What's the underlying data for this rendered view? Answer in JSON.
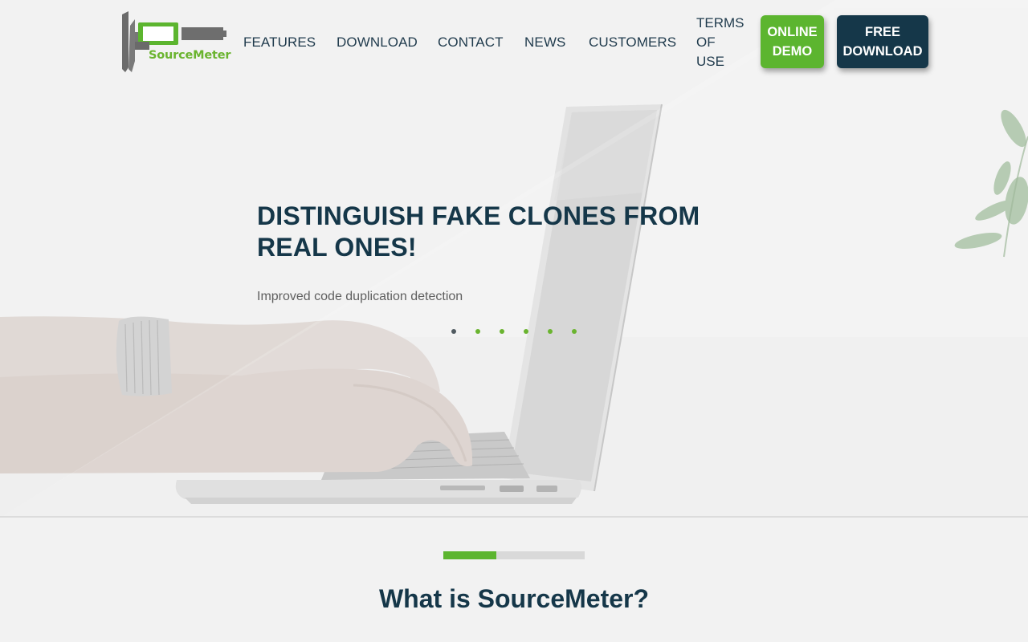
{
  "brand": {
    "logo_text": "SourceMeter",
    "primary_color": "#153749",
    "accent_color": "#5cb52f"
  },
  "nav": {
    "items": [
      "FEATURES",
      "DOWNLOAD",
      "CONTACT",
      "NEWS",
      "CUSTOMERS"
    ],
    "terms": [
      "TERMS",
      "OF",
      "USE"
    ]
  },
  "buttons": {
    "demo": [
      "ONLINE",
      "DEMO"
    ],
    "download": [
      "FREE",
      "DOWNLOAD"
    ]
  },
  "hero": {
    "title": "DISTINGUISH FAKE CLONES FROM REAL ONES!",
    "subtitle": "Improved code duplication detection",
    "slide_count": 6,
    "active_slide": 1
  },
  "intro": {
    "progress_fraction": 0.375,
    "title": "What is SourceMeter?"
  }
}
